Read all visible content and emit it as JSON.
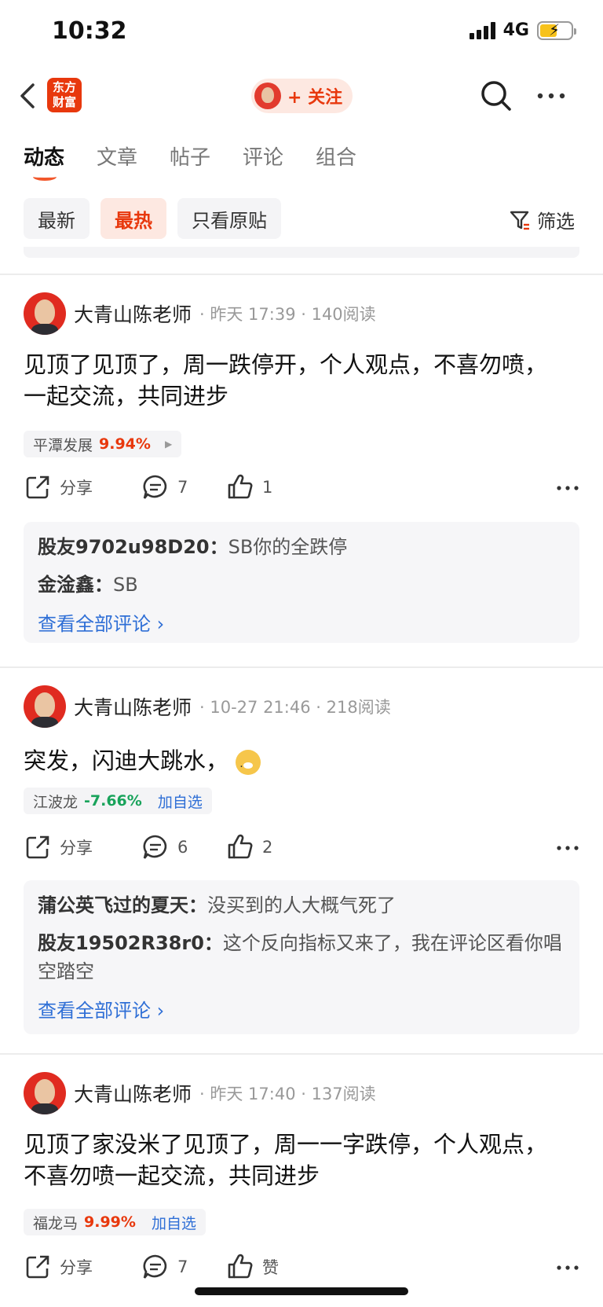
{
  "status_bar": {
    "time": "10:32",
    "network": "4G"
  },
  "nav": {
    "brand": "东方财富",
    "follow_label": "+ 关注"
  },
  "tabs": [
    "动态",
    "文章",
    "帖子",
    "评论",
    "组合"
  ],
  "filters": {
    "chips": [
      "最新",
      "最热",
      "只看原贴"
    ],
    "filter_label": "筛选"
  },
  "posts": [
    {
      "author": "大青山陈老师",
      "meta": "· 昨天 17:39 · 140阅读",
      "text": "见顶了见顶了，周一跌停开，个人观点，不喜勿喷，一起交流，共同进步",
      "stock": {
        "name": "平潭发展",
        "change": "9.94%",
        "direction": "up"
      },
      "share_label": "分享",
      "comment_count": "7",
      "like_count": "1",
      "comments": [
        {
          "user": "股友9702u98D20：",
          "text": "SB你的全跌停"
        },
        {
          "user": "金淦鑫：",
          "text": "SB"
        }
      ],
      "view_all": "查看全部评论 ›"
    },
    {
      "author": "大青山陈老师",
      "meta": "· 10-27 21:46 · 218阅读",
      "text": "突发，闪迪大跳水，",
      "stock": {
        "name": "江波龙",
        "change": "-7.66%",
        "direction": "down",
        "add": "加自选"
      },
      "share_label": "分享",
      "comment_count": "6",
      "like_count": "2",
      "comments": [
        {
          "user": "蒲公英飞过的夏天：",
          "text": "没买到的人大概气死了"
        },
        {
          "user": "股友19502R38r0：",
          "text": "这个反向指标又来了，我在评论区看你唱空踏空"
        }
      ],
      "view_all": "查看全部评论 ›"
    },
    {
      "author": "大青山陈老师",
      "meta": "· 昨天 17:40 · 137阅读",
      "text": "见顶了家没米了见顶了，周一一字跌停，个人观点，不喜勿喷一起交流，共同进步",
      "stock": {
        "name": "福龙马",
        "change": "9.99%",
        "direction": "up",
        "add": "加自选"
      },
      "share_label": "分享",
      "comment_count": "7",
      "like_count": "赞"
    }
  ],
  "colors": {
    "accent": "#e8380d",
    "link": "#2f6fd6",
    "up": "#e8380d",
    "down": "#19a35b"
  }
}
